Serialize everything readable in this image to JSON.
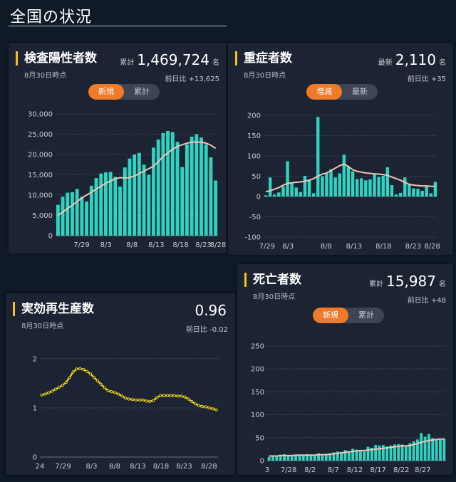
{
  "page": {
    "title": "全国の状況"
  },
  "panels": {
    "positive": {
      "title": "検査陽性者数",
      "date": "8月30日時点",
      "stat_label": "累計",
      "stat_value": "1,469,724",
      "stat_unit": "名",
      "diff": "前日比 +13,625",
      "toggle": [
        "新規",
        "累計"
      ]
    },
    "severe": {
      "title": "重症者数",
      "date": "8月30日時点",
      "stat_label": "最新",
      "stat_value": "2,110",
      "stat_unit": "名",
      "diff": "前日比 +35",
      "toggle": [
        "増減",
        "最新"
      ]
    },
    "rt": {
      "title": "実効再生産数",
      "date": "8月30日時点",
      "value": "0.96",
      "diff": "前日比 -0.02"
    },
    "deaths": {
      "title": "死亡者数",
      "date": "8月30日時点",
      "stat_label": "累計",
      "stat_value": "15,987",
      "stat_unit": "名",
      "diff": "前日比 +48",
      "toggle": [
        "新規",
        "累計"
      ]
    }
  },
  "colors": {
    "bar": "#2fd4c1",
    "avg_line": "#f0c5b4",
    "rt_line": "#e8d21f",
    "toggle_on": "#ee7a2a",
    "accent": "#f3c316"
  },
  "chart_data": [
    {
      "type": "bar",
      "title": "検査陽性者数",
      "x_ticks": [
        "7/29",
        "8/3",
        "8/8",
        "8/13",
        "8/18",
        "8/23",
        "8/28"
      ],
      "y_ticks": [
        "0",
        "5,000",
        "10,000",
        "15,000",
        "20,000",
        "25,000",
        "30,000"
      ],
      "ylim": [
        0,
        30000
      ],
      "series": [
        {
          "values": [
            7600,
            9600,
            10600,
            10700,
            11500,
            9600,
            8400,
            12300,
            14200,
            15300,
            15600,
            15700,
            14500,
            12100,
            16800,
            19000,
            20000,
            20400,
            17500,
            15000,
            21700,
            23700,
            25300,
            25800,
            25500,
            23100,
            16900,
            22500,
            24400,
            25000,
            24200,
            22500,
            19300,
            13600
          ]
        },
        {
          "type": "line",
          "values": [
            5000,
            5800,
            6700,
            7500,
            8400,
            9300,
            10000,
            10700,
            11500,
            12200,
            12900,
            13500,
            14000,
            14300,
            14200,
            14300,
            14700,
            15300,
            15900,
            16500,
            17100,
            18200,
            19500,
            20400,
            21300,
            22000,
            22400,
            22800,
            23000,
            23100,
            23000,
            22800,
            22300,
            21500
          ]
        }
      ]
    },
    {
      "type": "bar",
      "title": "重症者数",
      "x_ticks": [
        "7/29",
        "8/3",
        "8/8",
        "8/13",
        "8/18",
        "8/23",
        "8/28"
      ],
      "y_ticks": [
        "-100",
        "-50",
        "0",
        "50",
        "100",
        "150",
        "200"
      ],
      "ylim": [
        -100,
        200
      ],
      "series": [
        {
          "values": [
            3,
            47,
            5,
            10,
            25,
            87,
            35,
            22,
            11,
            51,
            42,
            8,
            196,
            50,
            58,
            67,
            47,
            57,
            103,
            73,
            62,
            43,
            45,
            40,
            42,
            57,
            48,
            51,
            72,
            28,
            5,
            9,
            47,
            31,
            20,
            19,
            14,
            26,
            8,
            36
          ]
        },
        {
          "type": "line",
          "values": [
            12,
            14,
            18,
            22,
            28,
            32,
            34,
            35,
            36,
            38,
            40,
            44,
            50,
            55,
            58,
            64,
            70,
            76,
            80,
            74,
            66,
            62,
            60,
            58,
            57,
            56,
            55,
            54,
            52,
            48,
            44,
            40,
            35,
            30,
            28,
            27,
            26,
            26,
            25,
            25
          ]
        }
      ]
    },
    {
      "type": "line",
      "title": "実効再生産数",
      "x_ticks": [
        "24",
        "7/29",
        "8/3",
        "8/8",
        "8/13",
        "8/18",
        "8/23",
        "8/28"
      ],
      "y_ticks": [
        "0",
        "1",
        "2"
      ],
      "ylim": [
        0,
        2.2
      ],
      "series": [
        {
          "values": [
            1.26,
            1.28,
            1.31,
            1.34,
            1.38,
            1.42,
            1.46,
            1.52,
            1.62,
            1.73,
            1.79,
            1.8,
            1.78,
            1.74,
            1.69,
            1.62,
            1.55,
            1.48,
            1.41,
            1.35,
            1.33,
            1.31,
            1.28,
            1.24,
            1.2,
            1.18,
            1.17,
            1.16,
            1.16,
            1.16,
            1.14,
            1.13,
            1.15,
            1.21,
            1.25,
            1.25,
            1.25,
            1.25,
            1.25,
            1.24,
            1.24,
            1.22,
            1.18,
            1.13,
            1.08,
            1.05,
            1.03,
            1.02,
            1.0,
            0.98,
            0.96
          ]
        }
      ]
    },
    {
      "type": "bar",
      "title": "死亡者数",
      "x_ticks": [
        "3",
        "7/28",
        "8/2",
        "8/7",
        "8/12",
        "8/17",
        "8/22",
        "8/27"
      ],
      "y_ticks": [
        "0",
        "50",
        "100",
        "150",
        "200",
        "250"
      ],
      "ylim": [
        0,
        270
      ],
      "series": [
        {
          "values": [
            8,
            10,
            11,
            13,
            14,
            12,
            11,
            12,
            13,
            12,
            14,
            13,
            11,
            16,
            14,
            15,
            16,
            18,
            20,
            19,
            23,
            21,
            26,
            24,
            22,
            20,
            30,
            28,
            34,
            33,
            34,
            31,
            33,
            35,
            36,
            35,
            32,
            38,
            42,
            46,
            60,
            52,
            58,
            49,
            47,
            45,
            48
          ]
        },
        {
          "type": "line",
          "values": [
            10,
            10,
            10,
            11,
            11,
            11,
            11,
            12,
            12,
            12,
            12,
            12,
            12,
            13,
            13,
            13,
            14,
            15,
            16,
            17,
            18,
            19,
            20,
            21,
            22,
            22,
            23,
            24,
            25,
            26,
            27,
            28,
            29,
            30,
            31,
            32,
            32,
            33,
            35,
            37,
            40,
            42,
            44,
            45,
            46,
            47,
            47
          ]
        }
      ]
    }
  ]
}
